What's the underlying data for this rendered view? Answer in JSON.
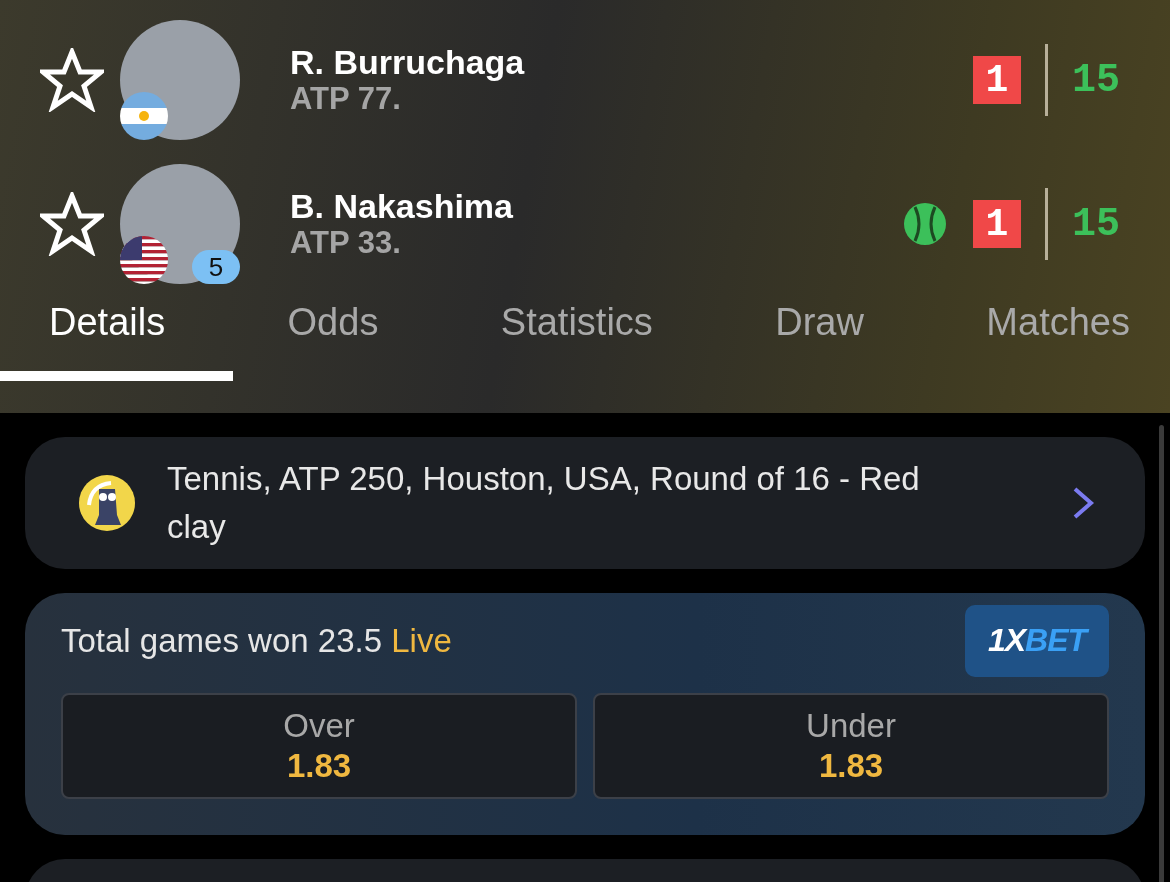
{
  "players": [
    {
      "name": "R. Burruchaga",
      "rank": "ATP 77.",
      "favorite": false,
      "kind": "argentina",
      "serving": false,
      "sets": "1",
      "points": "15"
    },
    {
      "name": "B. Nakashima",
      "rank": "ATP 33.",
      "favorite": false,
      "kind": "usa",
      "seed": "5",
      "serving": true,
      "sets": "1",
      "points": "15"
    }
  ],
  "tabs": [
    {
      "label": "Details",
      "selected": true
    },
    {
      "label": "Odds",
      "selected": false
    },
    {
      "label": "Statistics",
      "selected": false
    },
    {
      "label": "Draw",
      "selected": false
    },
    {
      "label": "Matches",
      "selected": false
    }
  ],
  "tournament": {
    "text": "Tennis, ATP 250, Houston, USA, Round of 16 - Red clay"
  },
  "odds": {
    "title": "Total games won 23.5",
    "status": "Live",
    "logo": {
      "lead": "1X",
      "tail": "BET"
    },
    "options": [
      {
        "label": "Over",
        "value": "1.83"
      },
      {
        "label": "Under",
        "value": "1.83"
      }
    ]
  }
}
